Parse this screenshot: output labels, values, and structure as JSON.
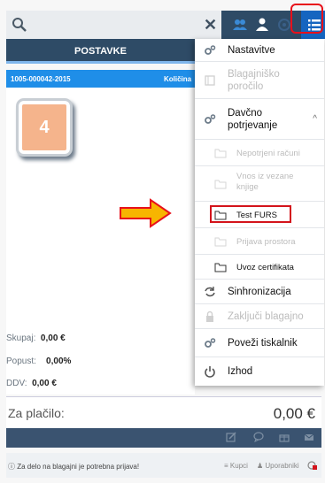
{
  "header": {
    "search_placeholder": "",
    "icons": [
      "search-icon",
      "clear-icon",
      "users-icon",
      "user-icon",
      "sync-icon",
      "menu-icon"
    ]
  },
  "tabs": [
    {
      "label": "POSTAVKE",
      "active": true
    }
  ],
  "document": {
    "number": "1005-000042-2015",
    "quantity_label": "Količina",
    "item_count": "4"
  },
  "summary": {
    "subtotal_label": "Skupaj:",
    "subtotal_value": "0,00 €",
    "discount_label": "Popust:",
    "discount_value": "0,00%",
    "vat_label": "DDV:",
    "vat_value": "0,00 €",
    "pay_label": "Za plačilo:",
    "pay_value": "0,00 €"
  },
  "status": {
    "message": "ⓘ Za delo na blagajni je potrebna prijava!",
    "kupci": "Kupci",
    "users": "Uporabniki"
  },
  "menu": {
    "items": [
      {
        "label": "Nastavitve",
        "enabled": true,
        "icon": "gears-icon"
      },
      {
        "label": "Blagajniško poročilo",
        "enabled": false,
        "icon": "report-icon"
      },
      {
        "label": "Davčno potrjevanje",
        "enabled": true,
        "icon": "gears-icon",
        "expanded": true
      },
      {
        "label": "Nepotrjeni računi",
        "enabled": false,
        "icon": "folder-icon"
      },
      {
        "label": "Vnos iz vezane knjige",
        "enabled": false,
        "icon": "folder-icon"
      },
      {
        "label": "Test FURS",
        "enabled": true,
        "icon": "folder-icon"
      },
      {
        "label": "Prijava prostora",
        "enabled": false,
        "icon": "folder-icon"
      },
      {
        "label": "Uvoz certifikata",
        "enabled": true,
        "icon": "folder-icon"
      },
      {
        "label": "Sinhronizacija",
        "enabled": true,
        "icon": "sync-icon"
      },
      {
        "label": "Zaključi blagajno",
        "enabled": false,
        "icon": "lock-icon"
      },
      {
        "label": "Poveži tiskalnik",
        "enabled": true,
        "icon": "gears-icon"
      },
      {
        "label": "Izhod",
        "enabled": true,
        "icon": "power-icon"
      }
    ]
  },
  "colors": {
    "header": "#2e4b66",
    "accent": "#1f8ee8",
    "highlight": "#e8101a",
    "arrow": "#f7b500"
  }
}
